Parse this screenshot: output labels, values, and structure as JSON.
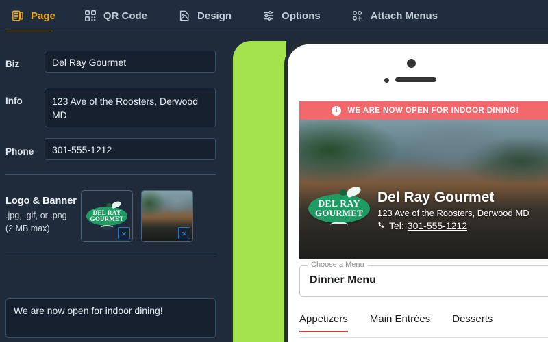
{
  "topbar": {
    "tabs": [
      {
        "label": "Page",
        "icon": "page-icon",
        "active": true
      },
      {
        "label": "QR Code",
        "icon": "qr-code-icon",
        "active": false
      },
      {
        "label": "Design",
        "icon": "design-icon",
        "active": false
      },
      {
        "label": "Options",
        "icon": "sliders-icon",
        "active": false
      },
      {
        "label": "Attach Menus",
        "icon": "attach-menus-icon",
        "active": false
      }
    ],
    "active_color": "#eda720"
  },
  "form": {
    "biz": {
      "label": "Biz",
      "value": "Del Ray Gourmet"
    },
    "info": {
      "label": "Info",
      "value": "123 Ave of the Roosters, Derwood MD"
    },
    "phone": {
      "label": "Phone",
      "value": "301-555-1212"
    },
    "uploads": {
      "title": "Logo & Banner",
      "formats": ".jpg, .gif, or .png",
      "maxsize": "(2 MB max)",
      "remove_glyph": "×",
      "logo_alt": "del-ray-gourmet-logo",
      "banner_alt": "restaurant-banner-photo"
    },
    "message": {
      "value": "We are now open for indoor dining!"
    }
  },
  "preview": {
    "alert": {
      "text": "WE ARE NOW OPEN FOR INDOOR DINING!",
      "icon": "info-icon",
      "color": "#f2686c"
    },
    "business": {
      "name": "Del Ray Gourmet",
      "address": "123 Ave of the Roosters, Derwood MD",
      "tel_prefix": "Tel:",
      "tel": "301-555-1212",
      "phone_icon": "phone-icon"
    },
    "logo": {
      "line1": "DEL RAY",
      "line2": "GOURMET",
      "color": "#1f9b63"
    },
    "menu_select": {
      "legend": "Choose a Menu",
      "value": "Dinner Menu"
    },
    "menu_tabs": [
      {
        "label": "Appetizers",
        "active": true
      },
      {
        "label": "Main Entrées",
        "active": false
      },
      {
        "label": "Desserts",
        "active": false
      }
    ],
    "accent_color": "#c9413f",
    "panel_color": "#a4e24e"
  }
}
